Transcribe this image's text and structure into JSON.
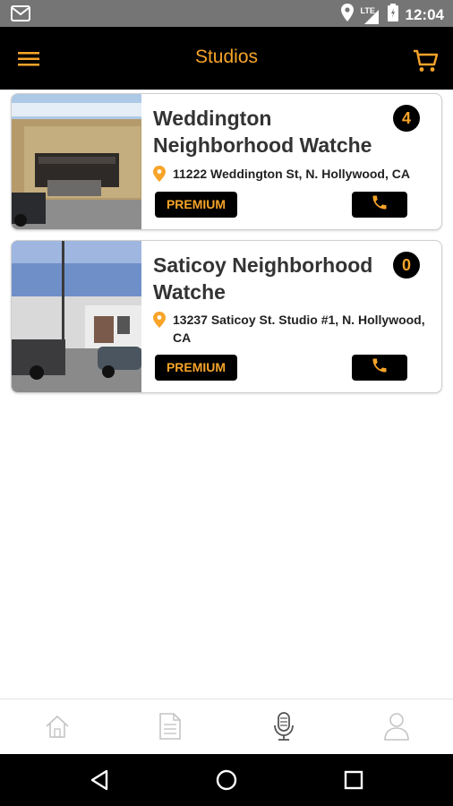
{
  "status_bar": {
    "time": "12:04",
    "network": "LTE",
    "icons": [
      "gmail-icon",
      "location-icon",
      "signal-icon",
      "battery-icon"
    ]
  },
  "app_bar": {
    "title": "Studios",
    "menu_icon": "hamburger-menu-icon",
    "cart_icon": "cart-icon"
  },
  "studios": [
    {
      "name": "Weddington Neighborhood Watche",
      "count": "4",
      "address": "11222 Weddington St, N. Hollywood, CA",
      "premium_label": "PREMIUM",
      "call_icon": "phone-icon"
    },
    {
      "name": "Saticoy Neighborhood Watche",
      "count": "0",
      "address": "13237 Saticoy St. Studio #1, N. Hollywood, CA",
      "premium_label": "PREMIUM",
      "call_icon": "phone-icon"
    }
  ],
  "bottom_tabs": [
    {
      "icon": "home-icon",
      "active": false
    },
    {
      "icon": "document-icon",
      "active": false
    },
    {
      "icon": "microphone-icon",
      "active": true
    },
    {
      "icon": "profile-icon",
      "active": false
    }
  ],
  "colors": {
    "accent": "#f7a429",
    "bar_background": "#000000",
    "status_bar": "#757575"
  }
}
